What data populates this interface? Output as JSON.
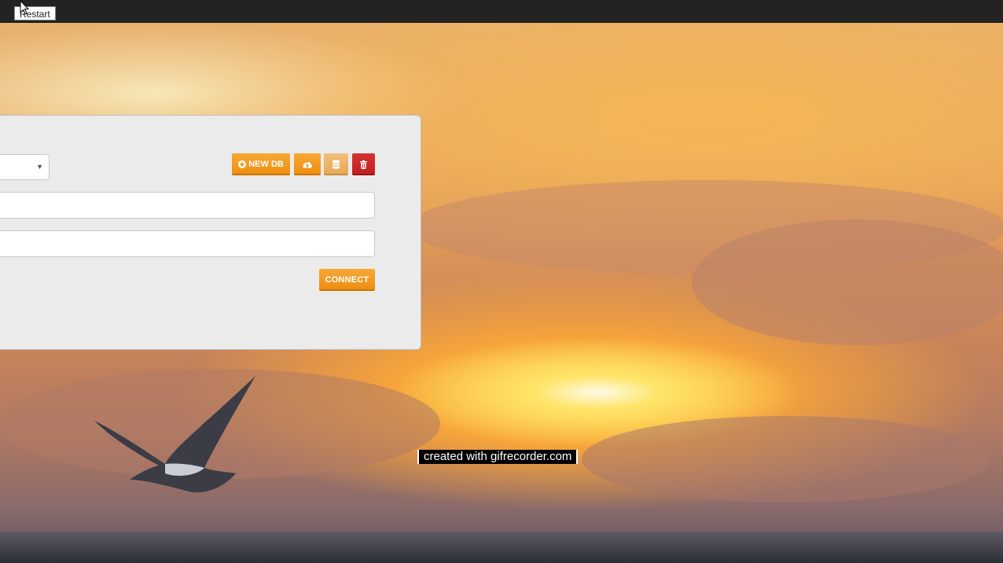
{
  "topbar": {
    "tooltip": "Restart"
  },
  "panel": {
    "toolbar": {
      "new_db_label": "NEW DB",
      "upload_icon": "cloud-upload-icon",
      "database_icon": "database-icon",
      "delete_icon": "trash-icon"
    },
    "select": {
      "value": ""
    },
    "field1": {
      "value": ""
    },
    "field2": {
      "value": ""
    },
    "connect_label": "CONNECT"
  },
  "watermark": "created with gifrecorder.com",
  "colors": {
    "accent": "#f0951a",
    "danger": "#c92626",
    "panel": "#ebebeb",
    "topbar": "#232323"
  }
}
